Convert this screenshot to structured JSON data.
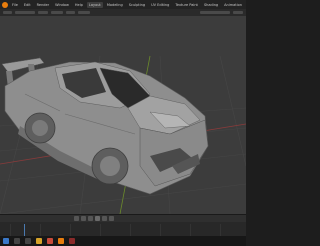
{
  "menubar": {
    "tabs": [
      "File",
      "Edit",
      "Render",
      "Window",
      "Help",
      "Layout",
      "Modeling",
      "Sculpting",
      "UV Editing",
      "Texture Paint",
      "Shading",
      "Animation",
      "Rendering",
      "Compositing",
      "Geometry Nodes",
      "Scripting"
    ],
    "active_index": 5
  },
  "viewport": {
    "background": "#3c3c3c",
    "grid_color": "#464646",
    "axis_red": "#8a3b3b",
    "axis_green": "#6b8a2b",
    "model_color": "#8e8e8e"
  },
  "icons": {
    "logo": "blender-logo-icon",
    "playback": [
      "jump-start-icon",
      "prev-key-icon",
      "play-reverse-icon",
      "play-icon",
      "next-key-icon",
      "jump-end-icon"
    ],
    "taskbar": [
      "start-icon",
      "search-icon",
      "taskview-icon",
      "explorer-icon",
      "chrome-icon",
      "blender-taskbar-icon",
      "app-icon"
    ]
  }
}
